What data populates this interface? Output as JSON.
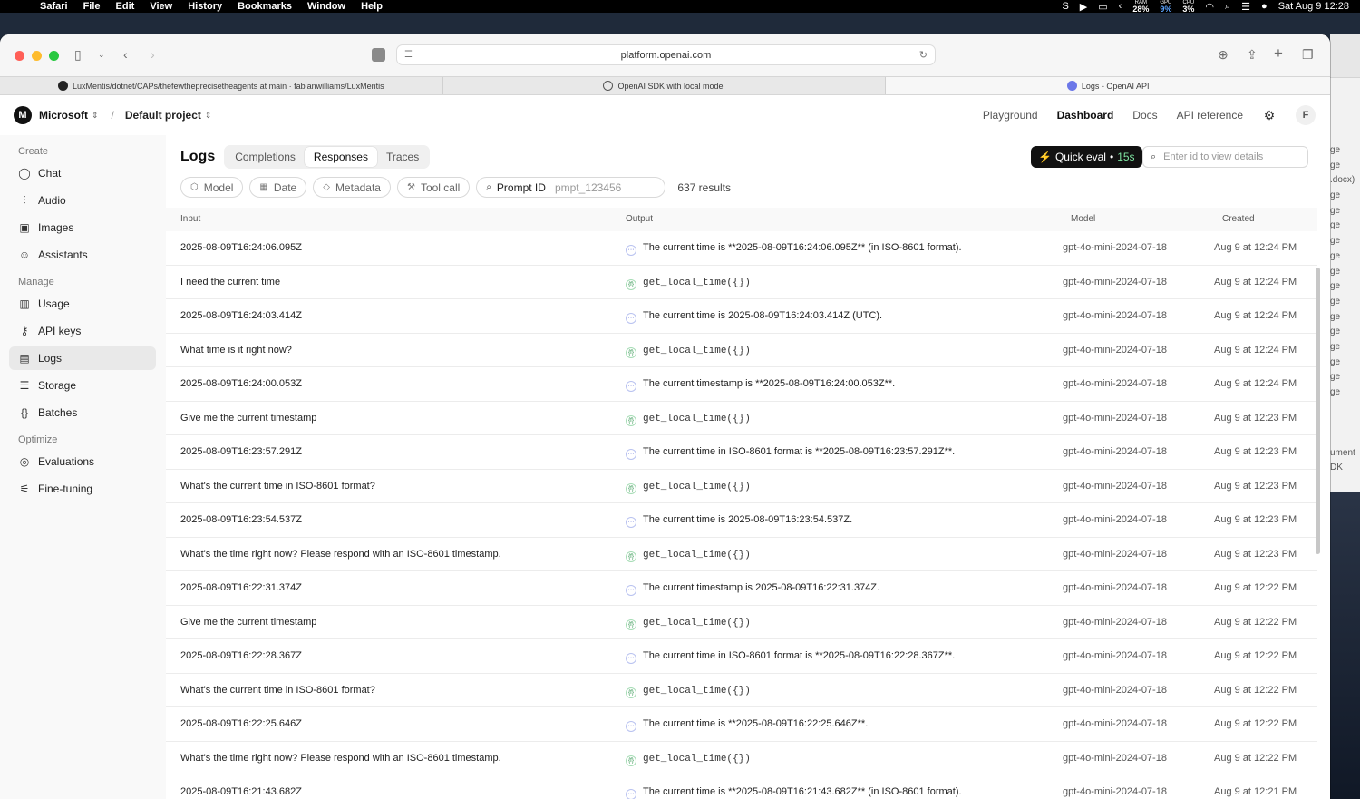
{
  "menubar": {
    "app": "Safari",
    "items": [
      "File",
      "Edit",
      "View",
      "History",
      "Bookmarks",
      "Window",
      "Help"
    ],
    "stats": [
      {
        "label": "RAM",
        "value": "28%"
      },
      {
        "label": "GPU",
        "value": "9%"
      },
      {
        "label": "CPU",
        "value": "3%"
      }
    ],
    "clock": "Sat Aug 9  12:28"
  },
  "browser": {
    "url": "platform.openai.com",
    "tabs": [
      {
        "title": "LuxMentis/dotnet/CAPs/thefewtheprecisetheagents at main · fabianwilliams/LuxMentis"
      },
      {
        "title": "OpenAI SDK with local model"
      },
      {
        "title": "Logs - OpenAI API"
      }
    ]
  },
  "background_window": {
    "lines": [
      "ge",
      "ge",
      ".docx)",
      "ge",
      "ge",
      "ge",
      "ge",
      "ge",
      "ge",
      "ge",
      "ge",
      "ge",
      "ge",
      "ge",
      "ge",
      "ge",
      "ge",
      "",
      "",
      "",
      "ument",
      "DK"
    ]
  },
  "header": {
    "org_initial": "M",
    "org": "Microsoft",
    "project": "Default project",
    "nav": [
      "Playground",
      "Dashboard",
      "Docs",
      "API reference"
    ],
    "user_initial": "F"
  },
  "sidebar": {
    "sections": [
      {
        "label": "Create",
        "items": [
          {
            "label": "Chat",
            "icon": "chat-icon"
          },
          {
            "label": "Audio",
            "icon": "audio-icon"
          },
          {
            "label": "Images",
            "icon": "images-icon"
          },
          {
            "label": "Assistants",
            "icon": "assistants-icon"
          }
        ]
      },
      {
        "label": "Manage",
        "items": [
          {
            "label": "Usage",
            "icon": "usage-icon"
          },
          {
            "label": "API keys",
            "icon": "key-icon"
          },
          {
            "label": "Logs",
            "icon": "logs-icon",
            "active": true
          },
          {
            "label": "Storage",
            "icon": "storage-icon"
          },
          {
            "label": "Batches",
            "icon": "batches-icon"
          }
        ]
      },
      {
        "label": "Optimize",
        "items": [
          {
            "label": "Evaluations",
            "icon": "evaluations-icon"
          },
          {
            "label": "Fine-tuning",
            "icon": "fine-tuning-icon"
          }
        ]
      }
    ]
  },
  "logs": {
    "title": "Logs",
    "tabs": [
      "Completions",
      "Responses",
      "Traces"
    ],
    "active_tab": "Responses",
    "quick_eval": {
      "label": "Quick eval",
      "time": "15s"
    },
    "id_search_placeholder": "Enter id to view details",
    "filters": [
      "Model",
      "Date",
      "Metadata",
      "Tool call"
    ],
    "prompt_filter": {
      "label": "Prompt ID",
      "placeholder": "pmpt_123456"
    },
    "results": "637 results",
    "columns": [
      "Input",
      "Output",
      "Model",
      "Created"
    ],
    "rows": [
      {
        "input": "2025-08-09T16:24:06.095Z",
        "type": "message",
        "output": "The current time is **2025-08-09T16:24:06.095Z** (in ISO-8601 format).",
        "model": "gpt-4o-mini-2024-07-18",
        "created": "Aug 9 at 12:24 PM"
      },
      {
        "input": "I need the current time",
        "type": "tool",
        "output": "get_local_time({})",
        "model": "gpt-4o-mini-2024-07-18",
        "created": "Aug 9 at 12:24 PM"
      },
      {
        "input": "2025-08-09T16:24:03.414Z",
        "type": "message",
        "output": "The current time is 2025-08-09T16:24:03.414Z (UTC).",
        "model": "gpt-4o-mini-2024-07-18",
        "created": "Aug 9 at 12:24 PM"
      },
      {
        "input": "What time is it right now?",
        "type": "tool",
        "output": "get_local_time({})",
        "model": "gpt-4o-mini-2024-07-18",
        "created": "Aug 9 at 12:24 PM"
      },
      {
        "input": "2025-08-09T16:24:00.053Z",
        "type": "message",
        "output": "The current timestamp is **2025-08-09T16:24:00.053Z**.",
        "model": "gpt-4o-mini-2024-07-18",
        "created": "Aug 9 at 12:24 PM"
      },
      {
        "input": "Give me the current timestamp",
        "type": "tool",
        "output": "get_local_time({})",
        "model": "gpt-4o-mini-2024-07-18",
        "created": "Aug 9 at 12:23 PM"
      },
      {
        "input": "2025-08-09T16:23:57.291Z",
        "type": "message",
        "output": "The current time in ISO-8601 format is **2025-08-09T16:23:57.291Z**.",
        "model": "gpt-4o-mini-2024-07-18",
        "created": "Aug 9 at 12:23 PM"
      },
      {
        "input": "What's the current time in ISO-8601 format?",
        "type": "tool",
        "output": "get_local_time({})",
        "model": "gpt-4o-mini-2024-07-18",
        "created": "Aug 9 at 12:23 PM"
      },
      {
        "input": "2025-08-09T16:23:54.537Z",
        "type": "message",
        "output": "The current time is 2025-08-09T16:23:54.537Z.",
        "model": "gpt-4o-mini-2024-07-18",
        "created": "Aug 9 at 12:23 PM"
      },
      {
        "input": "What's the time right now? Please respond with an ISO-8601 timestamp.",
        "type": "tool",
        "output": "get_local_time({})",
        "model": "gpt-4o-mini-2024-07-18",
        "created": "Aug 9 at 12:23 PM"
      },
      {
        "input": "2025-08-09T16:22:31.374Z",
        "type": "message",
        "output": "The current timestamp is 2025-08-09T16:22:31.374Z.",
        "model": "gpt-4o-mini-2024-07-18",
        "created": "Aug 9 at 12:22 PM"
      },
      {
        "input": "Give me the current timestamp",
        "type": "tool",
        "output": "get_local_time({})",
        "model": "gpt-4o-mini-2024-07-18",
        "created": "Aug 9 at 12:22 PM"
      },
      {
        "input": "2025-08-09T16:22:28.367Z",
        "type": "message",
        "output": "The current time in ISO-8601 format is **2025-08-09T16:22:28.367Z**.",
        "model": "gpt-4o-mini-2024-07-18",
        "created": "Aug 9 at 12:22 PM"
      },
      {
        "input": "What's the current time in ISO-8601 format?",
        "type": "tool",
        "output": "get_local_time({})",
        "model": "gpt-4o-mini-2024-07-18",
        "created": "Aug 9 at 12:22 PM"
      },
      {
        "input": "2025-08-09T16:22:25.646Z",
        "type": "message",
        "output": "The current time is **2025-08-09T16:22:25.646Z**.",
        "model": "gpt-4o-mini-2024-07-18",
        "created": "Aug 9 at 12:22 PM"
      },
      {
        "input": "What's the time right now? Please respond with an ISO-8601 timestamp.",
        "type": "tool",
        "output": "get_local_time({})",
        "model": "gpt-4o-mini-2024-07-18",
        "created": "Aug 9 at 12:22 PM"
      },
      {
        "input": "2025-08-09T16:21:43.682Z",
        "type": "message",
        "output": "The current time is **2025-08-09T16:21:43.682Z** (in ISO-8601 format).",
        "model": "gpt-4o-mini-2024-07-18",
        "created": "Aug 9 at 12:21 PM"
      }
    ]
  }
}
